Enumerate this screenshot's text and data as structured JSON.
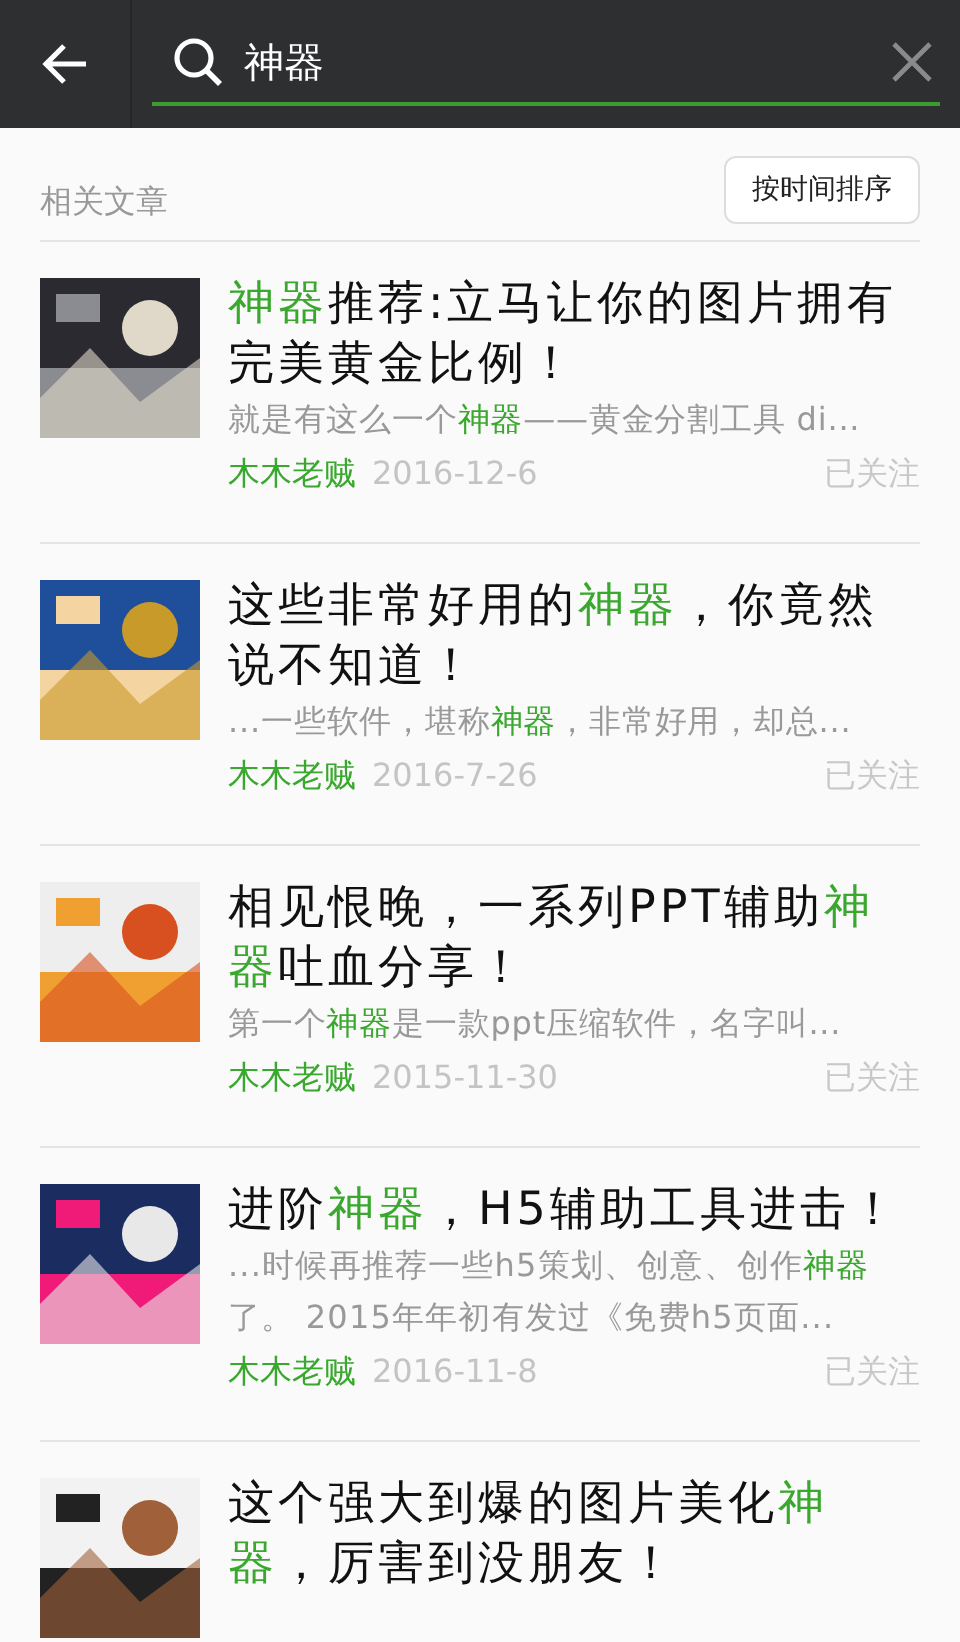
{
  "search": {
    "value": "神器"
  },
  "section": {
    "title": "相关文章",
    "sort_button": "按时间排序"
  },
  "articles": [
    {
      "title": [
        {
          "text": "神器",
          "highlight": true
        },
        {
          "text": "推荐:立马让你的图片拥有完美黄金比例！",
          "highlight": false
        }
      ],
      "snippet": [
        {
          "text": "就是有这么一个",
          "highlight": false
        },
        {
          "text": "神器",
          "highlight": true
        },
        {
          "text": "——黄金分割工具 di...",
          "highlight": false
        }
      ],
      "author": "木木老贼",
      "date": "2016-12-6",
      "status": "已关注"
    },
    {
      "title": [
        {
          "text": "这些非常好用的",
          "highlight": false
        },
        {
          "text": "神器",
          "highlight": true
        },
        {
          "text": "，你竟然说不知道！",
          "highlight": false
        }
      ],
      "snippet": [
        {
          "text": "...一些软件，堪称",
          "highlight": false
        },
        {
          "text": "神器",
          "highlight": true
        },
        {
          "text": "，非常好用，却总...",
          "highlight": false
        }
      ],
      "author": "木木老贼",
      "date": "2016-7-26",
      "status": "已关注"
    },
    {
      "title": [
        {
          "text": "相见恨晚，一系列PPT辅助",
          "highlight": false
        },
        {
          "text": "神器",
          "highlight": true
        },
        {
          "text": "吐血分享！",
          "highlight": false
        }
      ],
      "snippet": [
        {
          "text": "第一个",
          "highlight": false
        },
        {
          "text": "神器",
          "highlight": true
        },
        {
          "text": "是一款ppt压缩软件，名字叫...",
          "highlight": false
        }
      ],
      "author": "木木老贼",
      "date": "2015-11-30",
      "status": "已关注"
    },
    {
      "title": [
        {
          "text": "进阶",
          "highlight": false
        },
        {
          "text": "神器",
          "highlight": true
        },
        {
          "text": "，H5辅助工具进击！",
          "highlight": false
        }
      ],
      "snippet": [
        {
          "text": "...时候再推荐一些h5策划、创意、创作",
          "highlight": false
        },
        {
          "text": "神器",
          "highlight": true
        },
        {
          "text": "了。 2015年年初有发过《免费h5页面...",
          "highlight": false
        }
      ],
      "author": "木木老贼",
      "date": "2016-11-8",
      "status": "已关注"
    },
    {
      "title": [
        {
          "text": "这个强大到爆的图片美化",
          "highlight": false
        },
        {
          "text": "神器",
          "highlight": true
        },
        {
          "text": "，厉害到没朋友！",
          "highlight": false
        }
      ]
    }
  ]
}
